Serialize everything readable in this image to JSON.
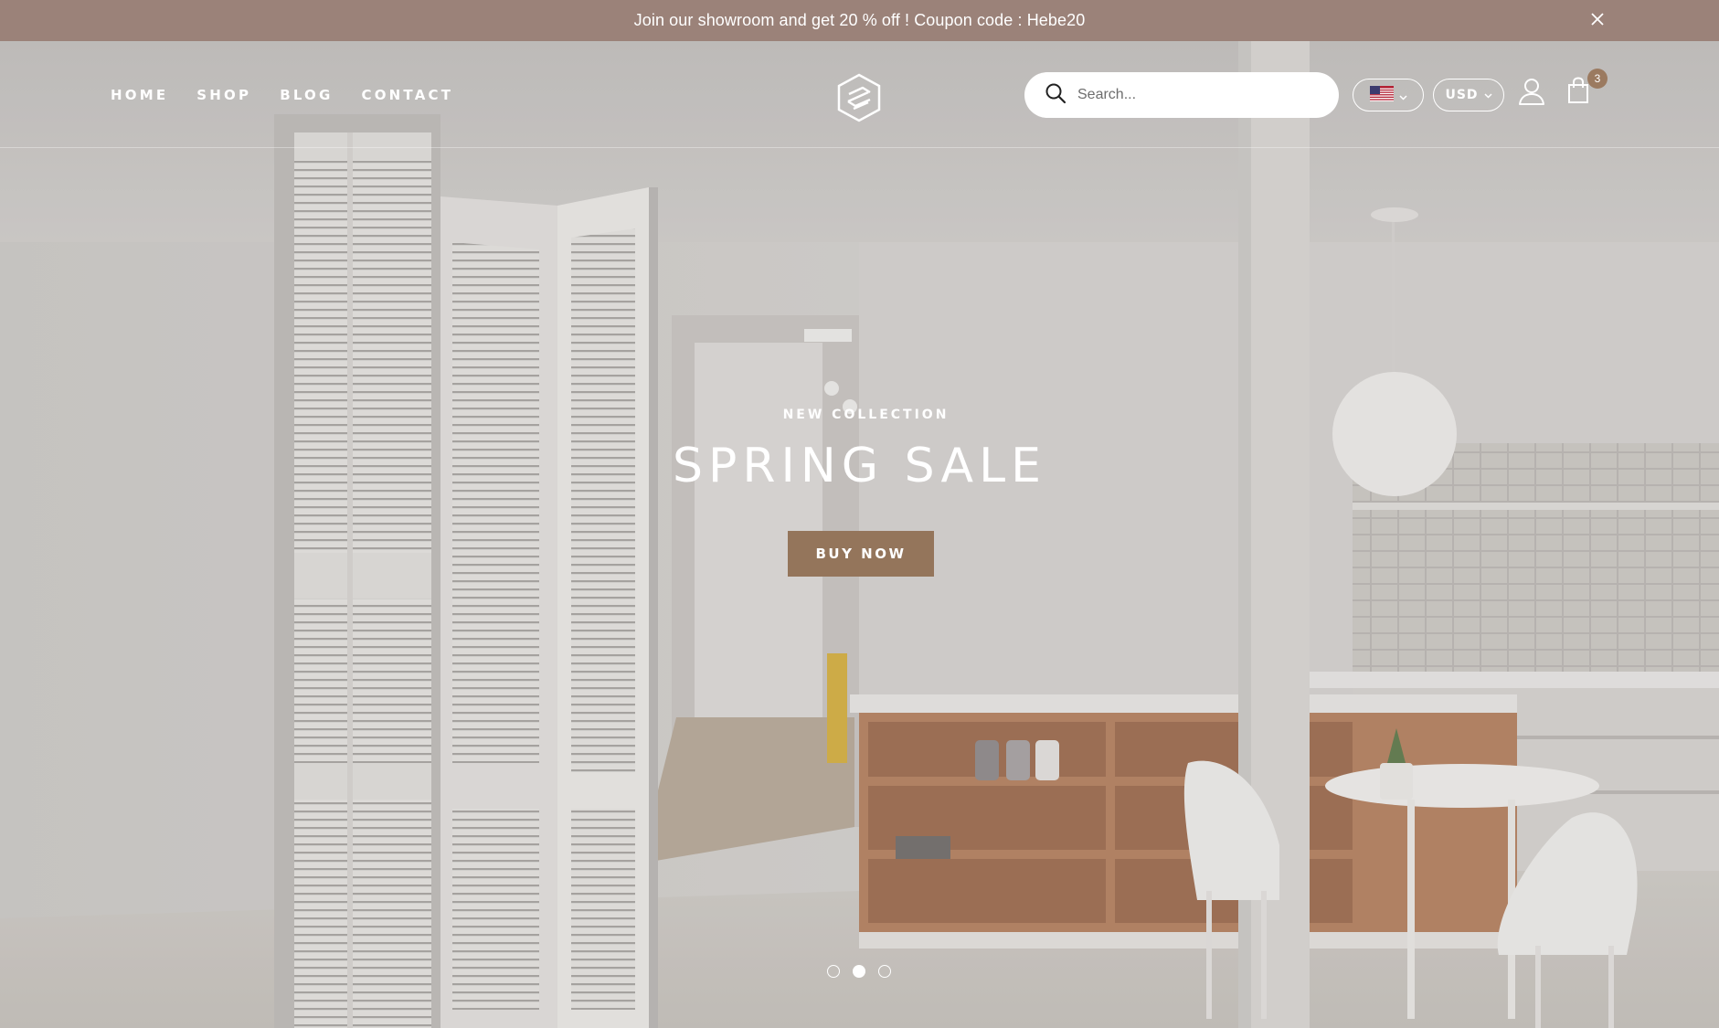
{
  "announcement": {
    "text": "Join our showroom and get 20 % off ! Coupon code : Hebe20",
    "close_icon": "close-icon",
    "background": "#9b8279"
  },
  "nav": {
    "items": [
      "HOME",
      "SHOP",
      "BLOG",
      "CONTACT"
    ]
  },
  "logo": {
    "icon": "brand-logo-icon"
  },
  "search": {
    "placeholder": "Search...",
    "value": "",
    "icon": "search-icon"
  },
  "language": {
    "selected": "en-US",
    "icon": "us-flag-icon"
  },
  "currency": {
    "selected": "USD"
  },
  "account": {
    "icon": "user-icon"
  },
  "cart": {
    "icon": "shopping-bag-icon",
    "count": "3",
    "badge_color": "#9b7a60"
  },
  "hero": {
    "subtitle": "NEW COLLECTION",
    "title": "SPRING SALE",
    "cta_label": "BUY NOW",
    "cta_color": "#94755b",
    "slides": 3,
    "active_slide": 2
  }
}
